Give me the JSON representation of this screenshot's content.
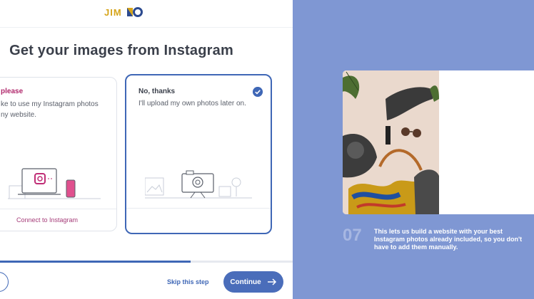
{
  "app": {
    "logo_text": "JIMDO",
    "page_title": "Get your images from Instagram"
  },
  "cards": {
    "yes": {
      "title": "please",
      "description": "ke to use my Instagram photos ny website.",
      "action": "Connect to Instagram"
    },
    "no": {
      "title": "No, thanks",
      "description": "I'll upload my own photos later on.",
      "selected": true
    }
  },
  "progress": {
    "value": 0.65
  },
  "footer": {
    "skip": "Skip this step",
    "continue": "Continue"
  },
  "colors": {
    "accent": "#3f67b6",
    "instagram_pink": "#b0276b",
    "right_panel": "#7f97d3"
  },
  "tour": {
    "step_number": "07",
    "step_text": "This lets us build a website with your best Instagram photos already included, so you don't have to add them manually."
  },
  "icons": [
    "check-icon",
    "arrow-right-icon",
    "instagram-laptop-illustration",
    "camera-illustration"
  ]
}
